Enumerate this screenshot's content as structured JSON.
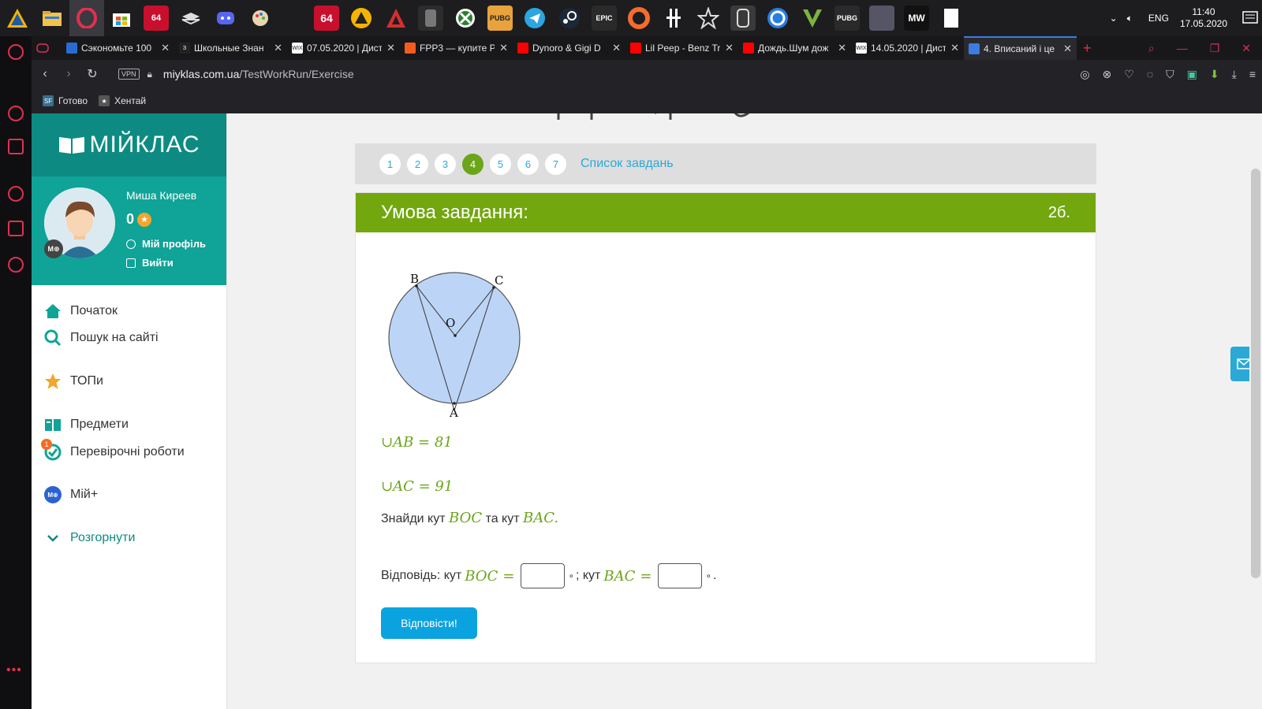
{
  "taskbar": {
    "icons": [
      "arctic-icon",
      "folder-icon",
      "opera-icon",
      "store-icon",
      "app-64-icon",
      "stack-icon",
      "discord-icon",
      "paint-icon",
      "app-64b-icon",
      "warning-icon",
      "apex-icon",
      "fallout-icon",
      "xbox-icon",
      "pubg-icon",
      "telegram-icon",
      "steam-icon",
      "epic-icon",
      "origin-icon",
      "knife-icon",
      "star-icon",
      "rainbow-six-icon",
      "uplay-icon",
      "gta-icon",
      "pubg2-icon",
      "game-cover-icon",
      "mw-icon",
      "file-icon"
    ],
    "icon_labels": {
      "app64": "64",
      "app64b": "64",
      "epic": "EPIC",
      "pubg": "PUBG",
      "pubg2": "PUBG",
      "mw": "MW"
    },
    "lang": "ENG",
    "time": "11:40",
    "date": "17.05.2020",
    "notif_count": "1"
  },
  "tabs": [
    {
      "label": "Сэкономьте 100",
      "fav_color": "#2a6bd1"
    },
    {
      "label": "Школьные Знан",
      "fav_color": "#222222",
      "fav_text": "З"
    },
    {
      "label": "07.05.2020 | Дист",
      "fav_color": "#ffffff",
      "fav_text": "WIX"
    },
    {
      "label": "FPP3 — купите Р",
      "fav_color": "#f25c1f"
    },
    {
      "label": "Dynoro & Gigi D",
      "fav_color": "#ff0000"
    },
    {
      "label": "Lil Peep - Benz Tr",
      "fav_color": "#ff0000"
    },
    {
      "label": "Дождь.Шум дож",
      "fav_color": "#ff0000"
    },
    {
      "label": "14.05.2020 | Дист",
      "fav_color": "#ffffff",
      "fav_text": "WIX"
    },
    {
      "label": "4. Вписаний і це",
      "fav_color": "#3b7ce0",
      "active": true
    }
  ],
  "address": {
    "vpn": "VPN",
    "domain": "miyklas.com.ua",
    "path": "/TestWorkRun/Exercise"
  },
  "bookmarks": [
    {
      "label": "Готово",
      "icon_text": "SF",
      "color": "#3a6e8e"
    },
    {
      "label": "Хентай",
      "icon_text": "★",
      "color": "#555555"
    }
  ],
  "site": {
    "logo": "МІЙКЛАС",
    "user": {
      "name": "Миша Киреев",
      "points": "0",
      "badge": "M⊕",
      "profile_link": "Мій профіль",
      "logout_link": "Вийти"
    },
    "menu": [
      {
        "label": "Початок",
        "icon": "home-icon"
      },
      {
        "label": "Пошук на сайті",
        "icon": "search-icon"
      },
      {
        "label": "ТОПи",
        "icon": "star-icon"
      },
      {
        "label": "Предмети",
        "icon": "book-icon"
      },
      {
        "label": "Перевірочні роботи",
        "icon": "check-icon",
        "badge": "1"
      },
      {
        "label": "Мій+",
        "icon": "my-plus-icon",
        "badge": "M⊕"
      },
      {
        "label": "Розгорнути",
        "icon": "chevron-down-icon"
      }
    ]
  },
  "exercise": {
    "steps": [
      "1",
      "2",
      "3",
      "4",
      "5",
      "6",
      "7"
    ],
    "current_step": "4",
    "task_list_link": "Список завдань",
    "header": "Умова завдання:",
    "points": "2б.",
    "figure_labels": {
      "B": "B",
      "C": "C",
      "O": "O",
      "A": "A"
    },
    "arc_ab_name": "AB",
    "arc_ab_value": "81",
    "arc_ac_name": "AC",
    "arc_ac_value": "91",
    "question_prefix": "Знайди кут",
    "question_angle1": "BOC",
    "question_mid": "та кут",
    "question_angle2": "BAC",
    "question_end": ".",
    "answer_prefix": "Відповідь: кут",
    "answer_angle1": "BOC",
    "answer_mid": "; кут",
    "answer_angle2": "BAC",
    "answer_value1": "",
    "answer_value2": "",
    "submit_label": "Відповісти!"
  },
  "colors": {
    "teal": "#0d8b82",
    "green": "#72a70e",
    "blue": "#0aa3e0",
    "circle_fill": "#bcd5f7"
  }
}
